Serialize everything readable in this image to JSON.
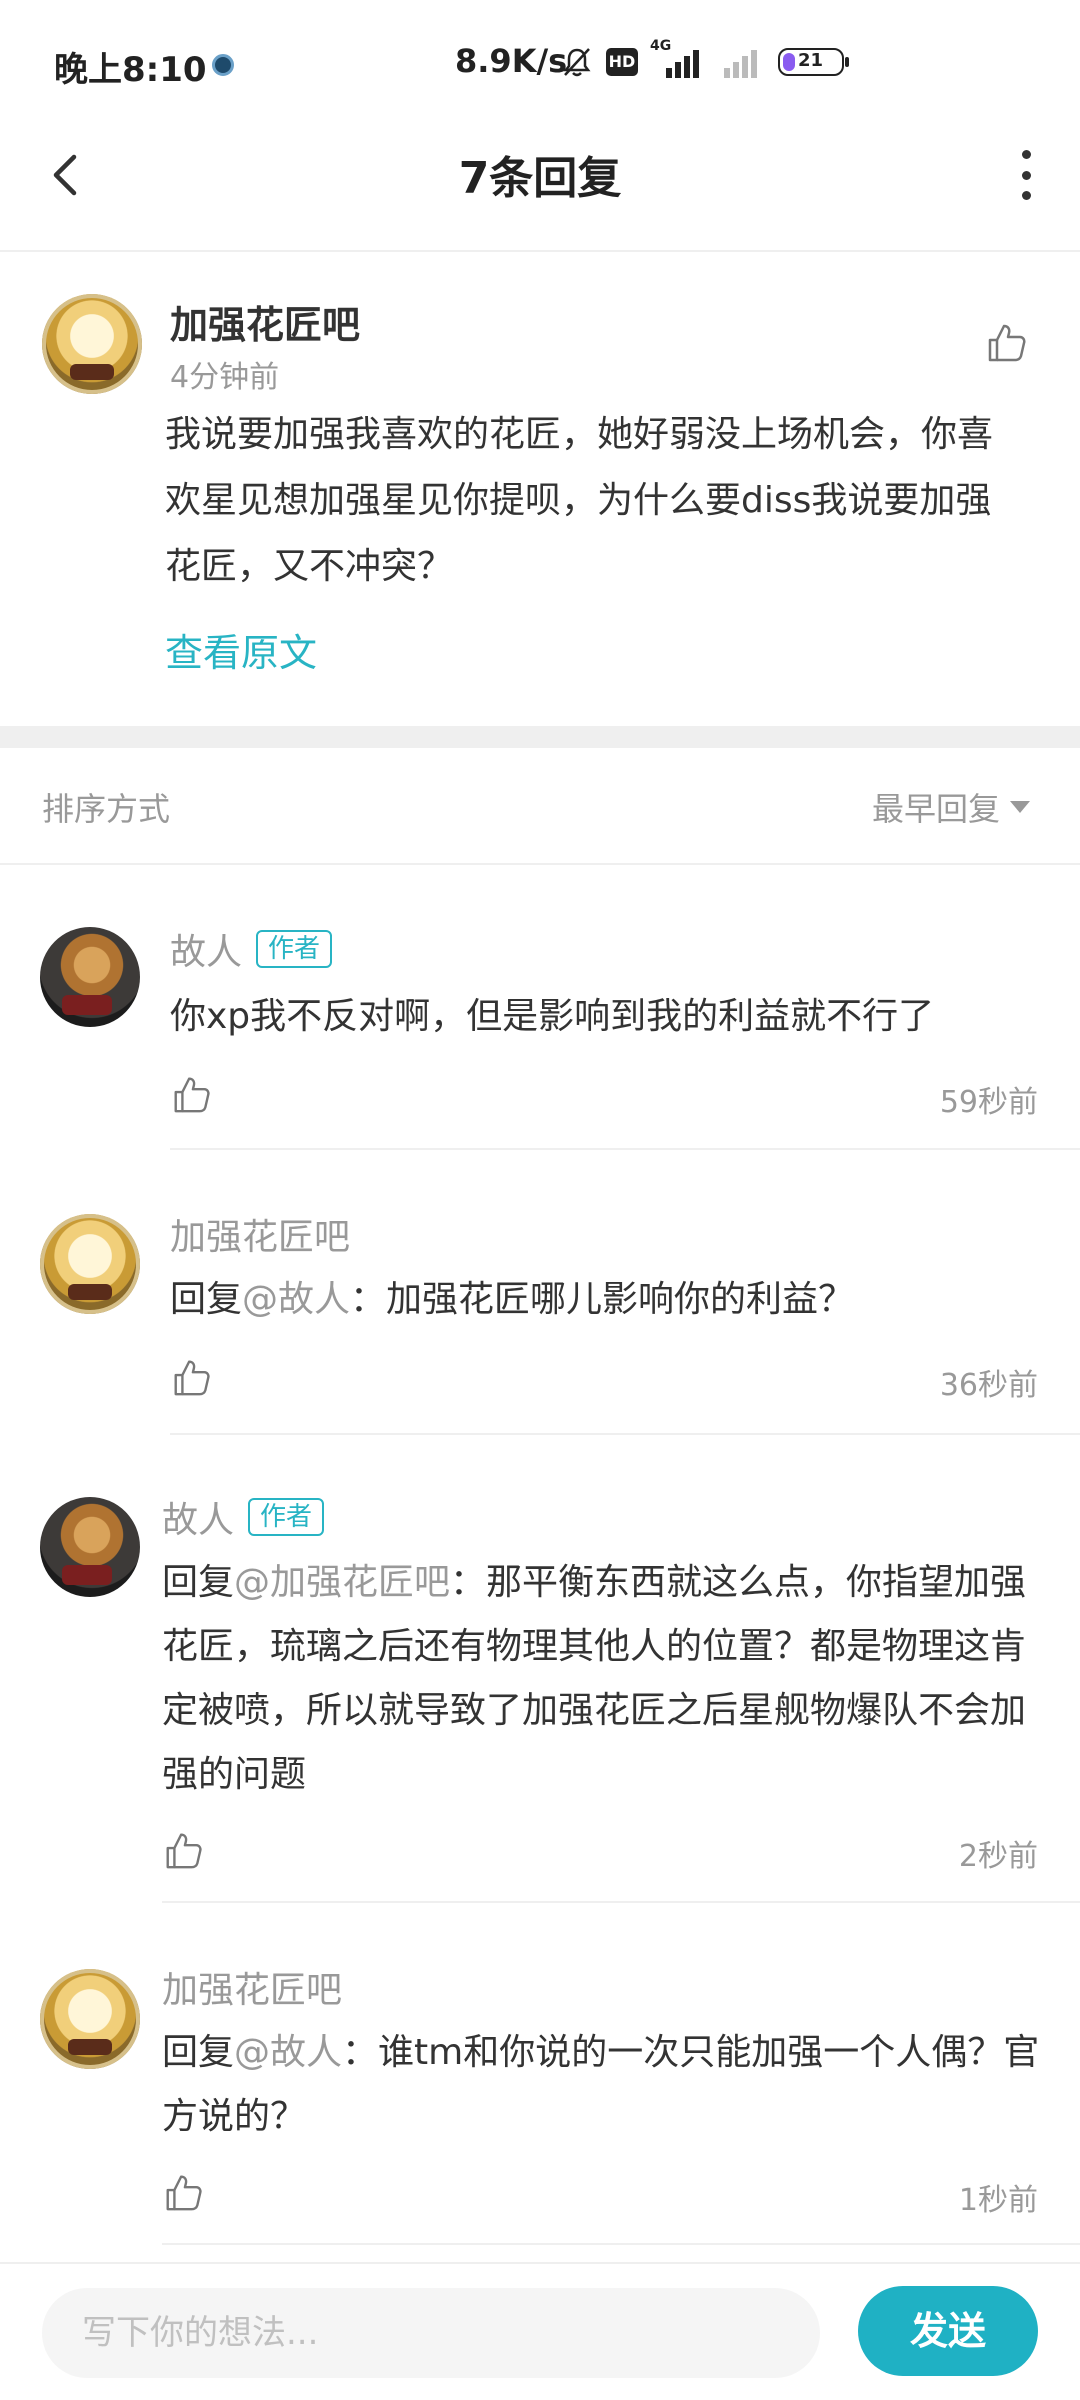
{
  "status_bar": {
    "time": "晚上8:10",
    "speed": "8.9K/s",
    "hd": "HD",
    "network": "4G",
    "battery": "21"
  },
  "header": {
    "title": "7条回复"
  },
  "original": {
    "name": "加强花匠吧",
    "time": "4分钟前",
    "body": "我说要加强我喜欢的花匠，她好弱没上场机会，你喜欢星见想加强星见你提呗，为什么要diss我说要加强花匠，又不冲突？",
    "view_original": "查看原文"
  },
  "sort": {
    "label": "排序方式",
    "value": "最早回复"
  },
  "replies": [
    {
      "name": "故人",
      "badge": "作者",
      "prefix": "",
      "mention": "",
      "text": "你xp我不反对啊，但是影响到我的利益就不行了",
      "time": "59秒前"
    },
    {
      "name": "加强花匠吧",
      "badge": "",
      "prefix": "回复",
      "mention": "@故人",
      "text": "：加强花匠哪儿影响你的利益？",
      "time": "36秒前"
    },
    {
      "name": "故人",
      "badge": "作者",
      "prefix": "回复",
      "mention": "@加强花匠吧",
      "text": "：那平衡东西就这么点，你指望加强花匠，琉璃之后还有物理其他人的位置？都是物理这肯定被喷，所以就导致了加强花匠之后星舰物爆队不会加强的问题",
      "time": "2秒前"
    },
    {
      "name": "加强花匠吧",
      "badge": "",
      "prefix": "回复",
      "mention": "@故人",
      "text": "：谁tm和你说的一次只能加强一个人偶？官方说的？",
      "time": "1秒前"
    }
  ],
  "input": {
    "placeholder": "写下你的想法...",
    "send": "发送"
  },
  "colors": {
    "accent": "#1fb1c4",
    "muted": "#999999"
  }
}
